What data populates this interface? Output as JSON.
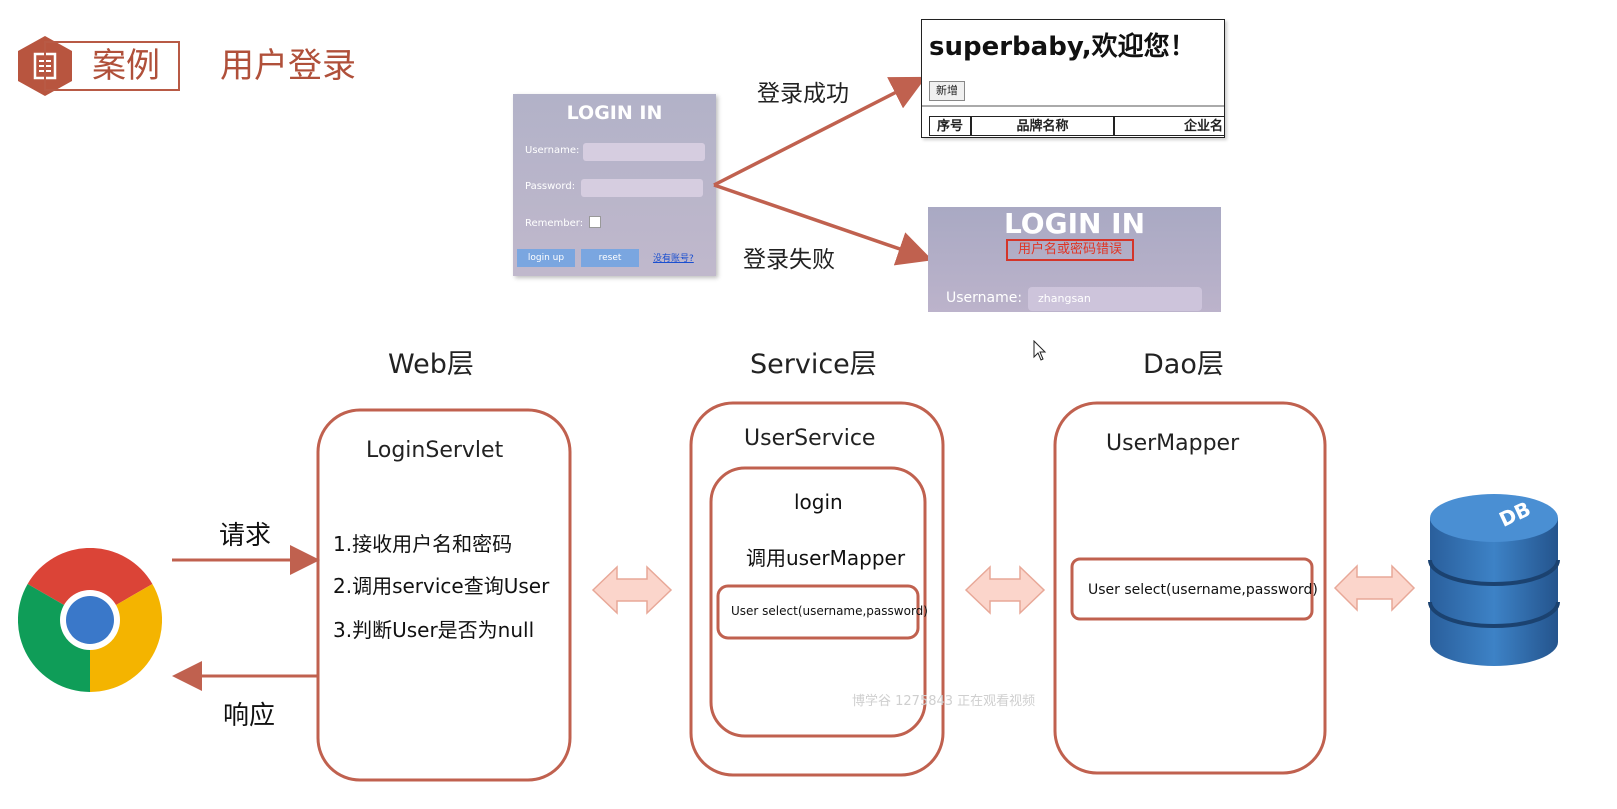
{
  "header": {
    "label": "案例",
    "title": "用户登录"
  },
  "login_form": {
    "title": "LOGIN IN",
    "username_label": "Username:",
    "password_label": "Password:",
    "remember_label": "Remember:",
    "login_button": "login up",
    "reset_button": "reset",
    "register_link": "没有账号?"
  },
  "branches": {
    "success": "登录成功",
    "failure": "登录失败"
  },
  "success_page": {
    "welcome": "superbaby,欢迎您！",
    "add_button": "新增",
    "columns": [
      "序号",
      "品牌名称",
      "企业名"
    ]
  },
  "failure_page": {
    "title": "LOGIN IN",
    "error": "用户名或密码错误",
    "username_label": "Username:",
    "username_value": "zhangsan"
  },
  "layers": {
    "web": "Web层",
    "service": "Service层",
    "dao": "Dao层"
  },
  "web": {
    "component": "LoginServlet",
    "steps": [
      "1.接收用户名和密码",
      "2.调用service查询User",
      "3.判断User是否为null"
    ]
  },
  "service": {
    "component": "UserService",
    "method": "login",
    "call": "调用userMapper",
    "signature": "User select(username,password)"
  },
  "dao": {
    "component": "UserMapper",
    "signature": "User select(username,password)"
  },
  "client": {
    "request": "请求",
    "response": "响应"
  },
  "database": {
    "label": "DB"
  },
  "watermark": "博学谷 1275843 正在观看视频",
  "colors": {
    "accent": "#b85a45",
    "box_border": "#c0614f",
    "db_blue": "#2f6fb0"
  }
}
